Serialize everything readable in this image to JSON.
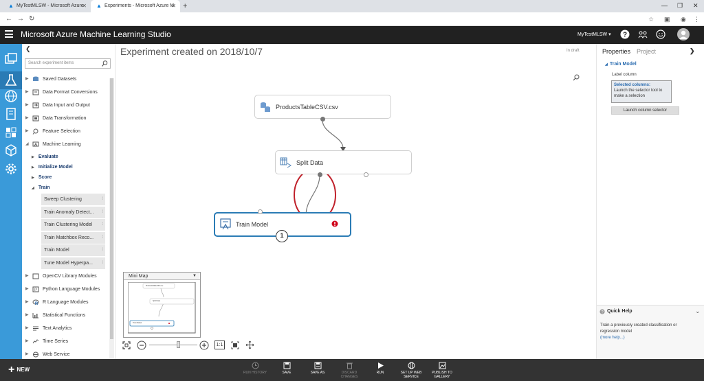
{
  "browser": {
    "tabs": [
      {
        "label": "MyTestMLSW - Microsoft Azure"
      },
      {
        "label": "Experiments - Microsoft Azure M"
      }
    ]
  },
  "header": {
    "title": "Microsoft Azure Machine Learning Studio",
    "workspace": "MyTestMLSW"
  },
  "palette": {
    "search_placeholder": "Search experiment items",
    "categories_top": [
      {
        "label": "Saved Datasets",
        "icon": "dataset-icon"
      },
      {
        "label": "Data Format Conversions",
        "icon": "convert-icon"
      },
      {
        "label": "Data Input and Output",
        "icon": "io-icon"
      },
      {
        "label": "Data Transformation",
        "icon": "transform-icon"
      },
      {
        "label": "Feature Selection",
        "icon": "feature-icon"
      },
      {
        "label": "Machine Learning",
        "icon": "ml-icon"
      }
    ],
    "subcategories": [
      "Evaluate",
      "Initialize Model",
      "Score",
      "Train"
    ],
    "train_modules": [
      "Sweep Clustering",
      "Train Anomaly Detect...",
      "Train Clustering Model",
      "Train Matchbox Reco...",
      "Train Model",
      "Tune Model Hyperpa..."
    ],
    "categories_bottom": [
      {
        "label": "OpenCV Library Modules",
        "icon": "opencv-icon"
      },
      {
        "label": "Python Language Modules",
        "icon": "python-icon"
      },
      {
        "label": "R Language Modules",
        "icon": "r-icon"
      },
      {
        "label": "Statistical Functions",
        "icon": "stats-icon"
      },
      {
        "label": "Text Analytics",
        "icon": "text-icon"
      },
      {
        "label": "Time Series",
        "icon": "timeseries-icon"
      },
      {
        "label": "Web Service",
        "icon": "web-icon"
      }
    ]
  },
  "canvas": {
    "title": "Experiment created on 2018/10/7",
    "status": "In draft",
    "nodes": [
      {
        "label": "ProductsTableCSV.csv"
      },
      {
        "label": "Split Data"
      },
      {
        "label": "Train Model",
        "badge": "1"
      }
    ],
    "minimap": {
      "title": "Mini Map",
      "nodes": [
        "ProductsTableCSV.csv",
        "Split Data",
        "Train Model"
      ]
    },
    "zoom_fit": "1:1"
  },
  "properties": {
    "tabs": [
      "Properties",
      "Project"
    ],
    "section": "Train Model",
    "field_label": "Label column",
    "selected_title": "Selected columns:",
    "selected_text": "Launch the selector tool to make a selection",
    "launch_button": "Launch column selector",
    "quick_help": {
      "title": "Quick Help",
      "text": "Train a previously created classification or regression model",
      "more": "(more help...)"
    }
  },
  "toolbar": {
    "new_label": "NEW",
    "run_history": "RUN HISTORY",
    "save": "SAVE",
    "save_as": "SAVE AS",
    "discard_1": "DISCARD",
    "discard_2": "CHANGES",
    "run": "RUN",
    "setup_1": "SET UP WEB",
    "setup_2": "SERVICE",
    "publish_1": "PUBLISH TO",
    "publish_2": "GALLERY"
  },
  "colors": {
    "rail": "#3a9ad9",
    "header": "#212121",
    "selected_node_border": "#2a7bb5",
    "error": "#d0021b",
    "annotation": "#c0212b"
  }
}
